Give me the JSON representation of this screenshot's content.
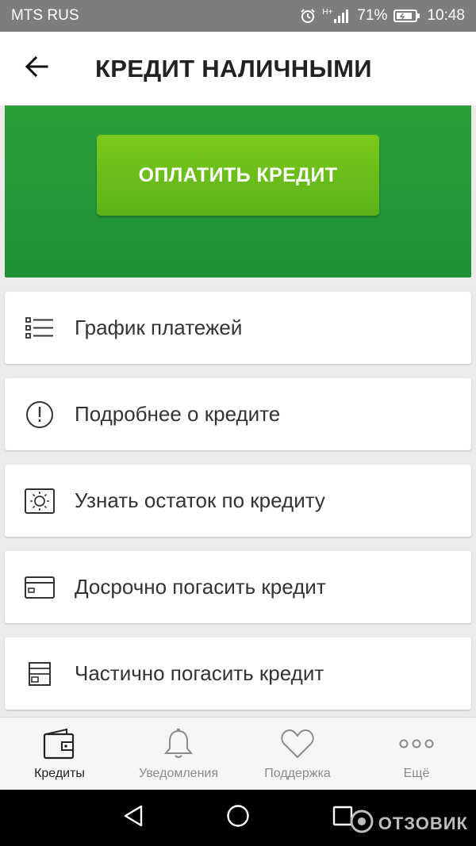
{
  "status_bar": {
    "carrier": "MTS RUS",
    "network": "H+",
    "battery_percent": "71%",
    "time": "10:48",
    "icons": [
      "alarm-icon",
      "signal-icon",
      "battery-icon"
    ]
  },
  "app_bar": {
    "title": "КРЕДИТ НАЛИЧНЫМИ",
    "back_icon": "arrow-left-icon"
  },
  "banner": {
    "pay_button_label": "ОПЛАТИТЬ КРЕДИТ"
  },
  "menu": {
    "items": [
      {
        "label": "График платежей",
        "icon": "list-icon"
      },
      {
        "label": "Подробнее о кредите",
        "icon": "info-circle-icon"
      },
      {
        "label": "Узнать остаток по кредиту",
        "icon": "sun-balance-icon"
      },
      {
        "label": "Досрочно погасить кредит",
        "icon": "card-icon"
      },
      {
        "label": "Частично погасить кредит",
        "icon": "document-icon"
      }
    ]
  },
  "bottom_nav": {
    "items": [
      {
        "label": "Кредиты",
        "icon": "wallet-icon",
        "active": true
      },
      {
        "label": "Уведомления",
        "icon": "bell-icon",
        "active": false
      },
      {
        "label": "Поддержка",
        "icon": "heart-icon",
        "active": false
      },
      {
        "label": "Ещё",
        "icon": "more-dots-icon",
        "active": false
      }
    ]
  },
  "watermark": {
    "text": "ОТЗОВИК"
  },
  "colors": {
    "banner_green": "#1f9136",
    "button_green": "#6cbd1a",
    "status_bar": "#7d7d7d",
    "background": "#ebebeb"
  }
}
